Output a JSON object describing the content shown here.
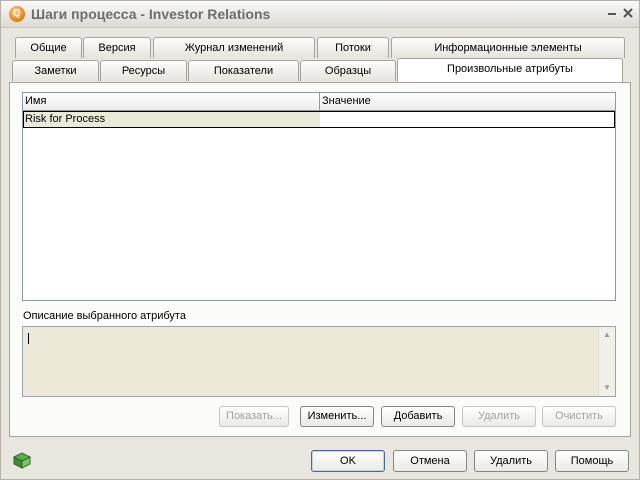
{
  "window": {
    "title": "Шаги процесса - Investor Relations"
  },
  "tabs_back": [
    {
      "label": "Общие"
    },
    {
      "label": "Версия"
    },
    {
      "label": "Журнал изменений"
    },
    {
      "label": "Потоки"
    },
    {
      "label": "Информационные элементы"
    }
  ],
  "tabs_front": [
    {
      "label": "Заметки"
    },
    {
      "label": "Ресурсы"
    },
    {
      "label": "Показатели"
    },
    {
      "label": "Образцы"
    },
    {
      "label": "Произвольные атрибуты"
    }
  ],
  "grid": {
    "columns": [
      "Имя",
      "Значение"
    ],
    "rows": [
      {
        "name": "Risk for Process",
        "value": ""
      }
    ]
  },
  "description": {
    "label": "Описание выбранного атрибута",
    "value": ""
  },
  "attr_buttons": {
    "show": "Показать...",
    "edit": "Изменить...",
    "add": "Добавить",
    "delete": "Удалить",
    "clear": "Очистить"
  },
  "dialog_buttons": {
    "ok": "OK",
    "cancel": "Отмена",
    "delete": "Удалить",
    "help": "Помощь"
  }
}
